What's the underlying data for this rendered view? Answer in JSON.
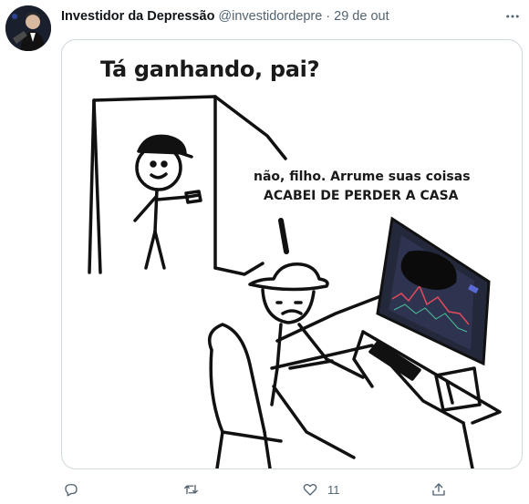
{
  "tweet": {
    "author": {
      "display_name": "Investidor da Depressão",
      "handle": "@investidordepre",
      "separator": "·",
      "time": "29 de out"
    },
    "menu_icon": "more-icon",
    "media": {
      "caption_top": "Tá ganhando, pai?",
      "caption_line_1": "não, filho. Arrume suas coisas",
      "caption_line_2": "ACABEI DE PERDER A CASA"
    },
    "actions": {
      "reply": {
        "icon": "reply-icon"
      },
      "retweet": {
        "icon": "retweet-icon"
      },
      "like": {
        "icon": "heart-icon",
        "count": "11"
      },
      "share": {
        "icon": "share-icon"
      }
    }
  },
  "colors": {
    "text_primary": "#0f1419",
    "text_secondary": "#536471",
    "border": "#cfd9de",
    "chart_screen": "#2a2f45"
  }
}
